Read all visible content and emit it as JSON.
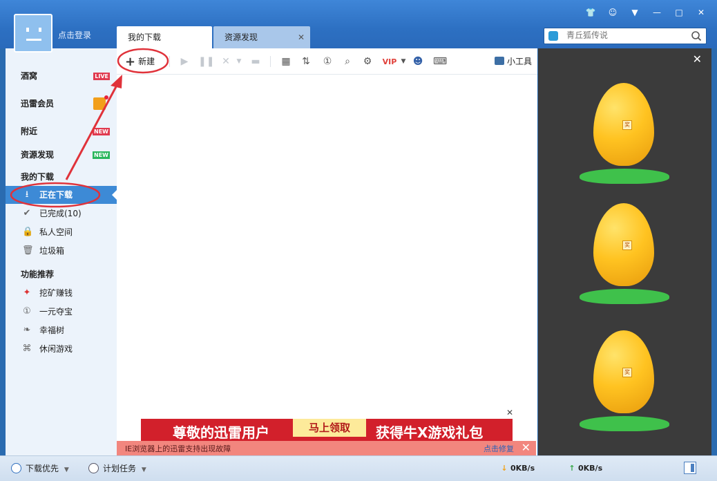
{
  "window": {
    "login_text": "点击登录",
    "controls": [
      "skin-icon",
      "user-icon",
      "menu-icon",
      "minimize-icon",
      "maximize-icon",
      "close-icon"
    ]
  },
  "tabs": [
    {
      "label": "我的下载",
      "active": true
    },
    {
      "label": "资源发现",
      "active": false
    }
  ],
  "search": {
    "placeholder": "青丘狐传说"
  },
  "sidebar": {
    "top_items": [
      {
        "label": "酒窝",
        "badge": "LIVE"
      },
      {
        "label": "迅雷会员",
        "badge": "gift"
      },
      {
        "label": "附近",
        "badge": "NEW"
      },
      {
        "label": "资源发现",
        "badge": "NEW"
      }
    ],
    "my_downloads_header": "我的下载",
    "downloads": [
      {
        "label": "正在下载",
        "selected": true
      },
      {
        "label": "已完成(10)"
      },
      {
        "label": "私人空间"
      },
      {
        "label": "垃圾箱"
      }
    ],
    "features_header": "功能推荐",
    "features": [
      {
        "label": "挖矿赚钱"
      },
      {
        "label": "一元夺宝"
      },
      {
        "label": "幸福树"
      },
      {
        "label": "休闲游戏"
      }
    ]
  },
  "toolbar": {
    "new_label": "新建",
    "tools_label": "小工具",
    "vip_label": "VIP"
  },
  "ad": {
    "text_left": "尊敬的迅雷用户",
    "button": "马上领取",
    "text_right": "获得牛X游戏礼包"
  },
  "alert": {
    "message": "IE浏览器上的迅雷支持出现故障",
    "action": "点击修复"
  },
  "right_panel": {
    "egg_tag": "奖",
    "egg_count": 3
  },
  "statusbar": {
    "priority_label": "下载优先",
    "plan_label": "计划任务",
    "download_speed": "0KB/s",
    "upload_speed": "0KB/s"
  },
  "colors": {
    "title_blue": "#2d70c2",
    "selected_blue": "#3d8ad6",
    "sidebar_bg": "#ecf3fb",
    "annotation_red": "#e0323a",
    "alert_bg": "#f2867e"
  }
}
